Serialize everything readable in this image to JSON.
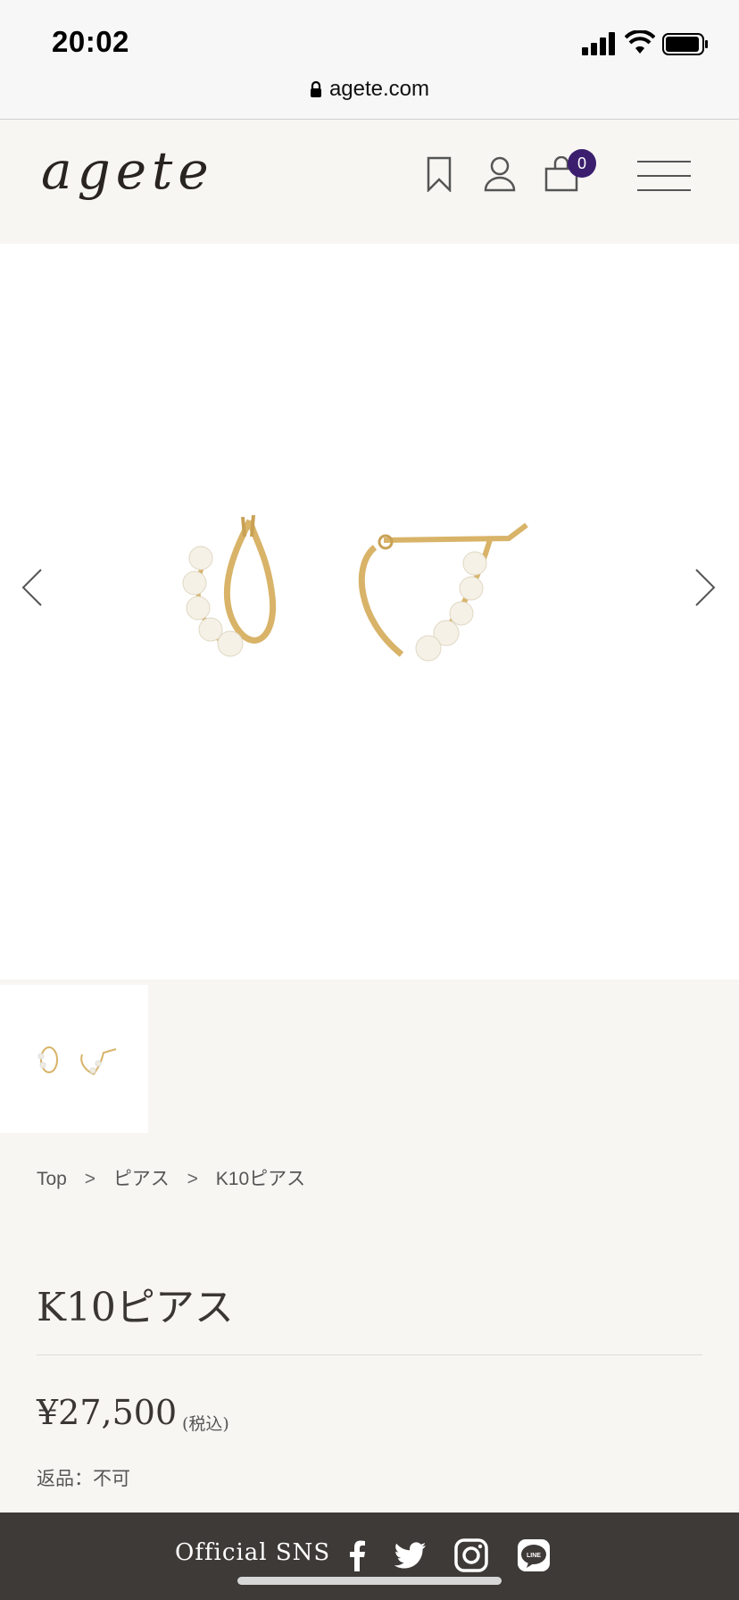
{
  "status_bar": {
    "time": "20:02",
    "url": "agete.com"
  },
  "header": {
    "logo": "agete",
    "cart_count": "0"
  },
  "gallery": {
    "thumbnail_count": 1
  },
  "breadcrumb": {
    "items": [
      "Top",
      "ピアス",
      "K10ピアス"
    ],
    "separator": ">"
  },
  "product": {
    "title": "K10ピアス",
    "price": "¥27,500",
    "tax_note": "(税込)",
    "return_policy": "返品：不可"
  },
  "footer": {
    "sns_label": "Official SNS"
  },
  "colors": {
    "badge": "#3b1f6e",
    "footer_bg": "#3e3a38",
    "page_bg": "#f7f6f3"
  }
}
